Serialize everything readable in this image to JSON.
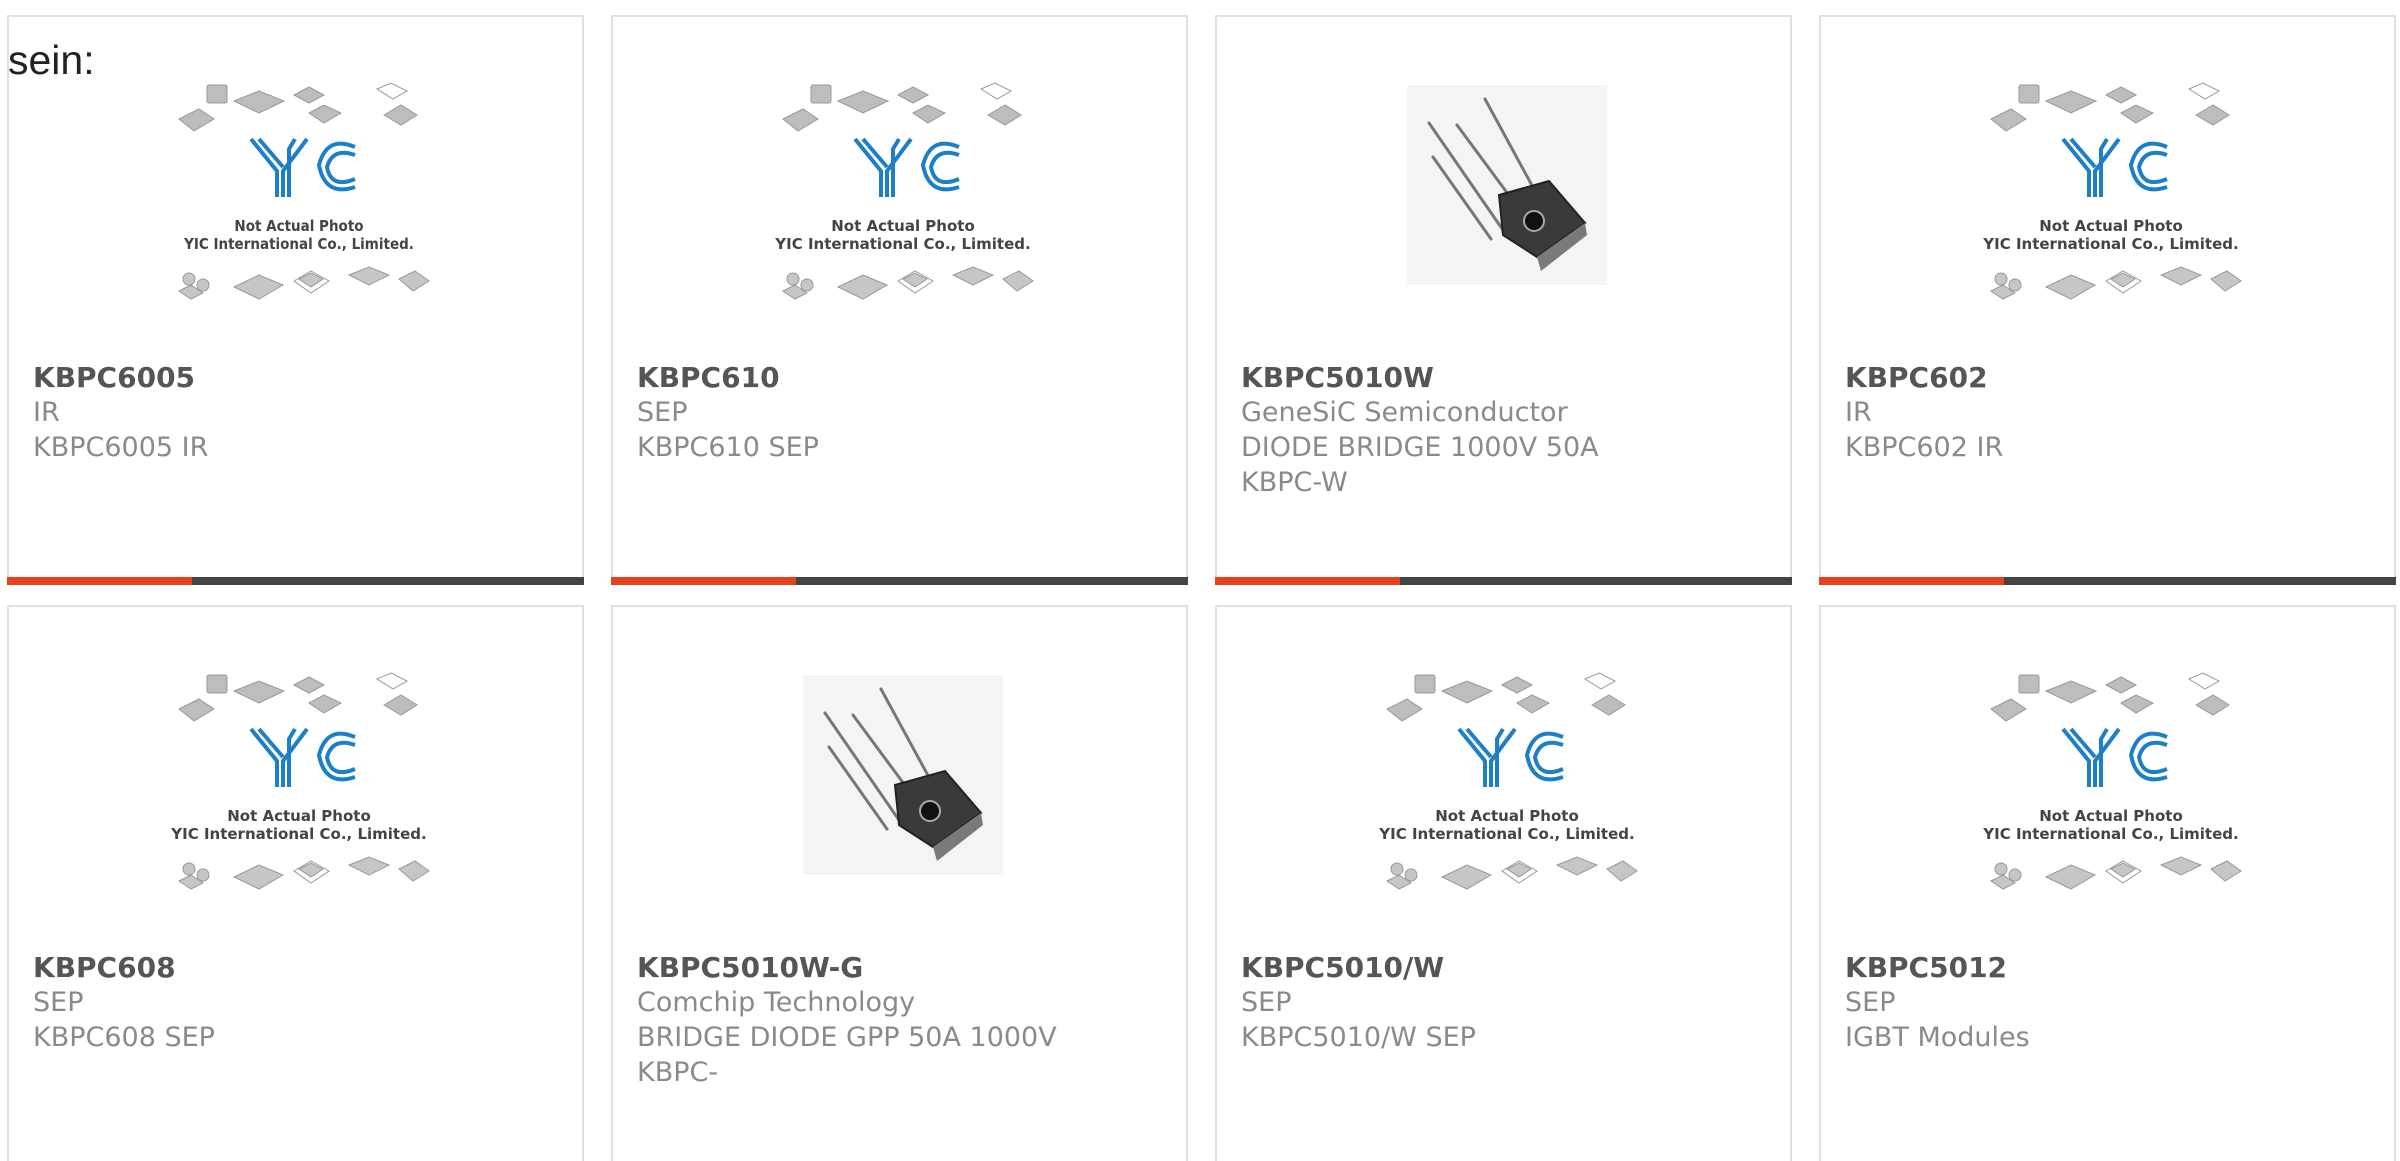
{
  "intro": {
    "text": "sein:"
  },
  "placeholder": {
    "line1": "Not Actual Photo",
    "line2": "YIC International Co., Limited.",
    "logo_text": "YIC"
  },
  "colors": {
    "accent": "#e5411a",
    "bar": "#444444",
    "logo_blue": "#1d7fc8"
  },
  "products": [
    {
      "pn": "KBPC6005",
      "mfr": "IR",
      "desc": "KBPC6005 IR",
      "image": "placeholder"
    },
    {
      "pn": "KBPC610",
      "mfr": "SEP",
      "desc": "KBPC610 SEP",
      "image": "placeholder"
    },
    {
      "pn": "KBPC5010W",
      "mfr": "GeneSiC Semiconductor",
      "desc": "DIODE BRIDGE 1000V 50A KBPC-W",
      "image": "bridge-rectifier-photo"
    },
    {
      "pn": "KBPC602",
      "mfr": "IR",
      "desc": "KBPC602 IR",
      "image": "placeholder"
    },
    {
      "pn": "KBPC608",
      "mfr": "SEP",
      "desc": "KBPC608 SEP",
      "image": "placeholder"
    },
    {
      "pn": "KBPC5010W-G",
      "mfr": "Comchip Technology",
      "desc": "BRIDGE DIODE GPP 50A 1000V KBPC-",
      "image": "bridge-rectifier-photo"
    },
    {
      "pn": "KBPC5010/W",
      "mfr": "SEP",
      "desc": "KBPC5010/W SEP",
      "image": "placeholder"
    },
    {
      "pn": "KBPC5012",
      "mfr": "SEP",
      "desc": "IGBT Modules",
      "image": "placeholder"
    }
  ]
}
